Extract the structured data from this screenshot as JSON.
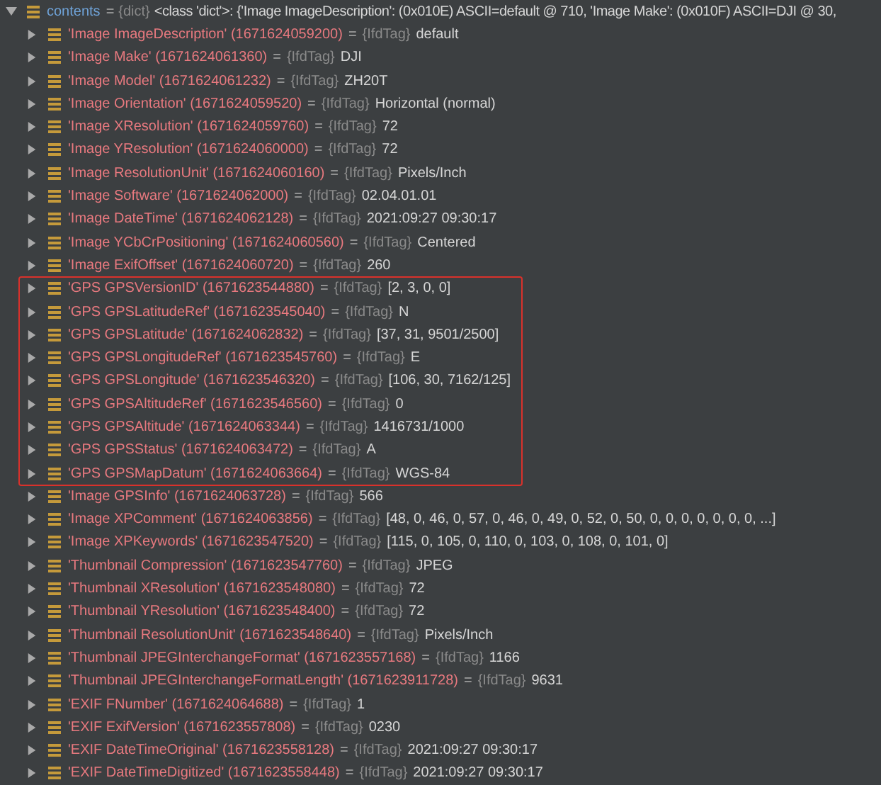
{
  "contents": {
    "name": "contents",
    "equals": "=",
    "type": "{dict}",
    "value": "<class 'dict'>: {'Image ImageDescription': (0x010E) ASCII=default @ 710, 'Image Make': (0x010F) ASCII=DJI @ 30,",
    "expanded": true,
    "children": [
      {
        "kind": "entry",
        "key": "'Image ImageDescription'",
        "id": "(1671624059200)",
        "equals": "=",
        "type": "{IfdTag}",
        "value": "default",
        "expanded": false
      },
      {
        "kind": "entry",
        "key": "'Image Make'",
        "id": "(1671624061360)",
        "equals": "=",
        "type": "{IfdTag}",
        "value": "DJI",
        "expanded": false
      },
      {
        "kind": "entry",
        "key": "'Image Model'",
        "id": "(1671624061232)",
        "equals": "=",
        "type": "{IfdTag}",
        "value": "ZH20T",
        "expanded": false
      },
      {
        "kind": "entry",
        "key": "'Image Orientation'",
        "id": "(1671624059520)",
        "equals": "=",
        "type": "{IfdTag}",
        "value": "Horizontal (normal)",
        "expanded": false
      },
      {
        "kind": "entry",
        "key": "'Image XResolution'",
        "id": "(1671624059760)",
        "equals": "=",
        "type": "{IfdTag}",
        "value": "72",
        "expanded": false
      },
      {
        "kind": "entry",
        "key": "'Image YResolution'",
        "id": "(1671624060000)",
        "equals": "=",
        "type": "{IfdTag}",
        "value": "72",
        "expanded": false
      },
      {
        "kind": "entry",
        "key": "'Image ResolutionUnit'",
        "id": "(1671624060160)",
        "equals": "=",
        "type": "{IfdTag}",
        "value": "Pixels/Inch",
        "expanded": false
      },
      {
        "kind": "entry",
        "key": "'Image Software'",
        "id": "(1671624062000)",
        "equals": "=",
        "type": "{IfdTag}",
        "value": "02.04.01.01",
        "expanded": false
      },
      {
        "kind": "entry",
        "key": "'Image DateTime'",
        "id": "(1671624062128)",
        "equals": "=",
        "type": "{IfdTag}",
        "value": "2021:09:27 09:30:17",
        "expanded": false
      },
      {
        "kind": "entry",
        "key": "'Image YCbCrPositioning'",
        "id": "(1671624060560)",
        "equals": "=",
        "type": "{IfdTag}",
        "value": "Centered",
        "expanded": false
      },
      {
        "kind": "entry",
        "key": "'Image ExifOffset'",
        "id": "(1671624060720)",
        "equals": "=",
        "type": "{IfdTag}",
        "value": "260",
        "expanded": false
      },
      {
        "kind": "highlight",
        "rows": [
          {
            "key": "'GPS GPSVersionID'",
            "id": "(1671623544880)",
            "equals": "=",
            "type": "{IfdTag}",
            "value": "[2, 3, 0, 0]",
            "expanded": false
          },
          {
            "key": "'GPS GPSLatitudeRef'",
            "id": "(1671623545040)",
            "equals": "=",
            "type": "{IfdTag}",
            "value": "N",
            "expanded": false
          },
          {
            "key": "'GPS GPSLatitude'",
            "id": "(1671624062832)",
            "equals": "=",
            "type": "{IfdTag}",
            "value": "[37, 31, 9501/2500]",
            "expanded": false
          },
          {
            "key": "'GPS GPSLongitudeRef'",
            "id": "(1671623545760)",
            "equals": "=",
            "type": "{IfdTag}",
            "value": "E",
            "expanded": false
          },
          {
            "key": "'GPS GPSLongitude'",
            "id": "(1671623546320)",
            "equals": "=",
            "type": "{IfdTag}",
            "value": "[106, 30, 7162/125]",
            "expanded": false
          },
          {
            "key": "'GPS GPSAltitudeRef'",
            "id": "(1671623546560)",
            "equals": "=",
            "type": "{IfdTag}",
            "value": "0",
            "expanded": false
          },
          {
            "key": "'GPS GPSAltitude'",
            "id": "(1671624063344)",
            "equals": "=",
            "type": "{IfdTag}",
            "value": "1416731/1000",
            "expanded": false
          },
          {
            "key": "'GPS GPSStatus'",
            "id": "(1671624063472)",
            "equals": "=",
            "type": "{IfdTag}",
            "value": "A",
            "expanded": false
          },
          {
            "key": "'GPS GPSMapDatum'",
            "id": "(1671624063664)",
            "equals": "=",
            "type": "{IfdTag}",
            "value": "WGS-84",
            "expanded": false
          }
        ]
      },
      {
        "kind": "entry",
        "key": "'Image GPSInfo'",
        "id": "(1671624063728)",
        "equals": "=",
        "type": "{IfdTag}",
        "value": "566",
        "expanded": false
      },
      {
        "kind": "entry",
        "key": "'Image XPComment'",
        "id": "(1671624063856)",
        "equals": "=",
        "type": "{IfdTag}",
        "value": "[48, 0, 46, 0, 57, 0, 46, 0, 49, 0, 52, 0, 50, 0, 0, 0, 0, 0, 0, 0, ...]",
        "expanded": false
      },
      {
        "kind": "entry",
        "key": "'Image XPKeywords'",
        "id": "(1671623547520)",
        "equals": "=",
        "type": "{IfdTag}",
        "value": "[115, 0, 105, 0, 110, 0, 103, 0, 108, 0, 101, 0]",
        "expanded": false
      },
      {
        "kind": "entry",
        "key": "'Thumbnail Compression'",
        "id": "(1671623547760)",
        "equals": "=",
        "type": "{IfdTag}",
        "value": "JPEG",
        "expanded": false
      },
      {
        "kind": "entry",
        "key": "'Thumbnail XResolution'",
        "id": "(1671623548080)",
        "equals": "=",
        "type": "{IfdTag}",
        "value": "72",
        "expanded": false
      },
      {
        "kind": "entry",
        "key": "'Thumbnail YResolution'",
        "id": "(1671623548400)",
        "equals": "=",
        "type": "{IfdTag}",
        "value": "72",
        "expanded": false
      },
      {
        "kind": "entry",
        "key": "'Thumbnail ResolutionUnit'",
        "id": "(1671623548640)",
        "equals": "=",
        "type": "{IfdTag}",
        "value": "Pixels/Inch",
        "expanded": false
      },
      {
        "kind": "entry",
        "key": "'Thumbnail JPEGInterchangeFormat'",
        "id": "(1671623557168)",
        "equals": "=",
        "type": "{IfdTag}",
        "value": "1166",
        "expanded": false
      },
      {
        "kind": "entry",
        "key": "'Thumbnail JPEGInterchangeFormatLength'",
        "id": "(1671623911728)",
        "equals": "=",
        "type": "{IfdTag}",
        "value": "9631",
        "expanded": false
      },
      {
        "kind": "entry",
        "key": "'EXIF FNumber'",
        "id": "(1671624064688)",
        "equals": "=",
        "type": "{IfdTag}",
        "value": "1",
        "expanded": false
      },
      {
        "kind": "entry",
        "key": "'EXIF ExifVersion'",
        "id": "(1671623557808)",
        "equals": "=",
        "type": "{IfdTag}",
        "value": "0230",
        "expanded": false
      },
      {
        "kind": "entry",
        "key": "'EXIF DateTimeOriginal'",
        "id": "(1671623558128)",
        "equals": "=",
        "type": "{IfdTag}",
        "value": "2021:09:27 09:30:17",
        "expanded": false
      },
      {
        "kind": "entry",
        "key": "'EXIF DateTimeDigitized'",
        "id": "(1671623558448)",
        "equals": "=",
        "type": "{IfdTag}",
        "value": "2021:09:27 09:30:17",
        "expanded": false
      }
    ]
  }
}
